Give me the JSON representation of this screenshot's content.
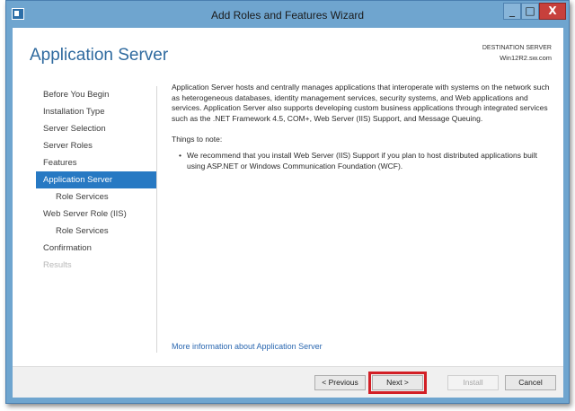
{
  "window": {
    "title": "Add Roles and Features Wizard",
    "controls": {
      "minimize": "_",
      "maximize": "□",
      "close": "X"
    }
  },
  "header": {
    "page_title": "Application Server",
    "destination_label": "DESTINATION SERVER",
    "destination_server": "Win12R2.sw.com"
  },
  "nav": {
    "items": [
      {
        "label": "Before You Begin",
        "state": "normal"
      },
      {
        "label": "Installation Type",
        "state": "normal"
      },
      {
        "label": "Server Selection",
        "state": "normal"
      },
      {
        "label": "Server Roles",
        "state": "normal"
      },
      {
        "label": "Features",
        "state": "normal"
      },
      {
        "label": "Application Server",
        "state": "active"
      },
      {
        "label": "Role Services",
        "state": "sub"
      },
      {
        "label": "Web Server Role (IIS)",
        "state": "normal"
      },
      {
        "label": "Role Services",
        "state": "sub"
      },
      {
        "label": "Confirmation",
        "state": "normal"
      },
      {
        "label": "Results",
        "state": "disabled"
      }
    ]
  },
  "content": {
    "description": "Application Server hosts and centrally manages applications that interoperate with systems on the network such as heterogeneous databases, identity management services, security systems, and Web applications and services. Application Server also supports developing custom business applications through integrated services such as the .NET Framework 4.5, COM+, Web Server (IIS) Support, and Message Queuing.",
    "note_title": "Things to note:",
    "bullets": [
      "We recommend that you install Web Server (IIS) Support if you plan to host distributed applications built using ASP.NET or Windows Communication Foundation (WCF)."
    ],
    "more_info_link": "More information about Application Server"
  },
  "footer": {
    "previous_label": "< Previous",
    "next_label": "Next >",
    "install_label": "Install",
    "cancel_label": "Cancel"
  },
  "colors": {
    "title_bar": "#6fa5cf",
    "accent": "#2779c3",
    "page_title": "#2f6a9f",
    "link": "#2a67b0",
    "highlight": "#d21f26",
    "close_button": "#c7403c"
  }
}
